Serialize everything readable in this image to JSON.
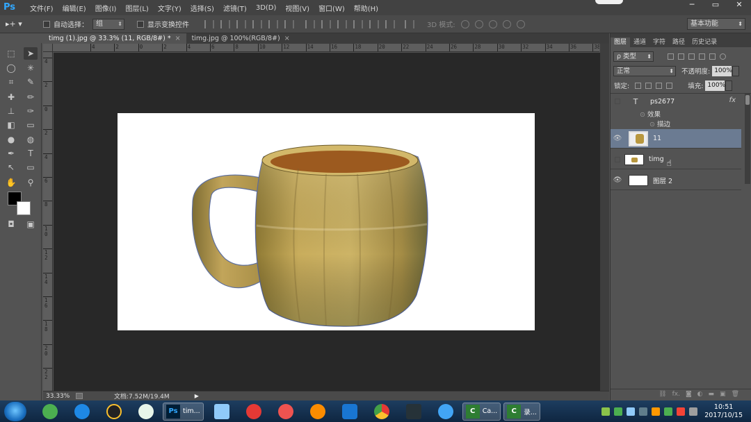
{
  "app": {
    "logo": "Ps",
    "menu": [
      "文件(F)",
      "编辑(E)",
      "图像(I)",
      "图层(L)",
      "文字(Y)",
      "选择(S)",
      "滤镜(T)",
      "3D(D)",
      "视图(V)",
      "窗口(W)",
      "帮助(H)"
    ],
    "window_buttons": {
      "minimize": "─",
      "maximize": "▭",
      "close": "✕"
    }
  },
  "options": {
    "tool_label": "▸+ ▾",
    "auto_select_label": "自动选择：",
    "auto_select_value": "组",
    "show_transform_label": "显示变换控件",
    "mode3d_label": "3D 模式:",
    "workspace": "基本功能"
  },
  "tabs": [
    {
      "title": "timg (1).jpg @ 33.3% (11, RGB/8#) *",
      "close": "×"
    },
    {
      "title": "timg.jpg @ 100%(RGB/8#)",
      "close": "×"
    }
  ],
  "rulers": {
    "h": [
      "4",
      "2",
      "0",
      "2",
      "4",
      "6",
      "8",
      "10",
      "12",
      "14",
      "16",
      "18",
      "20",
      "22",
      "24",
      "26",
      "28",
      "30",
      "32",
      "34",
      "36",
      "38",
      "40"
    ],
    "v": [
      "4",
      "2",
      "0",
      "2",
      "4",
      "6",
      "8",
      "1\n0",
      "1\n2",
      "1\n4",
      "1\n6",
      "1\n8",
      "2\n0",
      "2\n2"
    ]
  },
  "status": {
    "zoom": "33.33%",
    "doc_info": "文档:7.52M/19.4M",
    "arrow": "▶"
  },
  "panel": {
    "tabs": [
      "图层",
      "通道",
      "字符",
      "路径",
      "历史记录"
    ],
    "kind_label": "ρ 类型",
    "blend_mode": "正常",
    "opacity_label": "不透明度:",
    "opacity_value": "100%",
    "lock_label": "锁定:",
    "fill_label": "填充:",
    "fill_value": "100%",
    "layers": [
      {
        "name": "ps2677",
        "type": "text",
        "visible": false,
        "fx": "fx",
        "effects_label": "效果",
        "stroke_label": "描边"
      },
      {
        "name": "11",
        "type": "image",
        "visible": true,
        "selected": true
      },
      {
        "name": "timg",
        "type": "image",
        "visible": false
      },
      {
        "name": "图层 2",
        "type": "fill",
        "visible": true
      }
    ]
  },
  "taskbar": {
    "tasks": [
      {
        "icon": "Ps",
        "label": "tim..."
      },
      {
        "icon": "C",
        "label": "Ca..."
      },
      {
        "icon": "C",
        "label": "录..."
      }
    ],
    "time": "10:51",
    "date": "2017/10/15"
  },
  "colors": {
    "ps_blue": "#31a8ff",
    "selected_layer": "#6b7b92",
    "mug_body": "#c6a95a",
    "mug_inside": "#9c5a1f"
  }
}
